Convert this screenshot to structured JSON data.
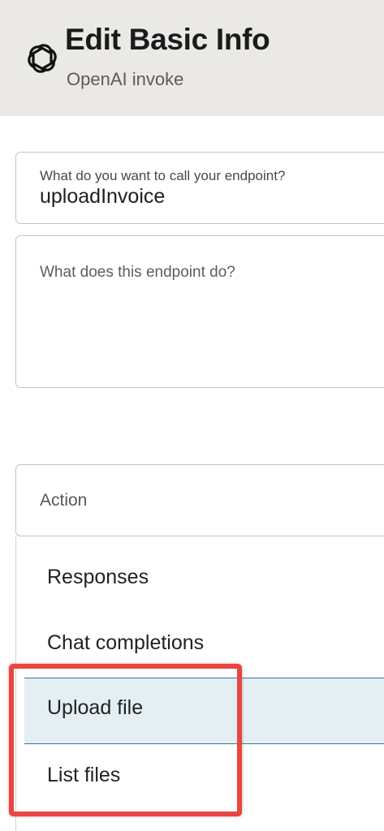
{
  "header": {
    "logo_icon": "openai-logo-icon",
    "title": "Edit Basic Info",
    "subtitle": "OpenAI invoke"
  },
  "form": {
    "endpoint_name": {
      "label": "What do you want to call your endpoint?",
      "value": "uploadInvoice"
    },
    "description": {
      "placeholder": "What does this endpoint do?",
      "value": ""
    },
    "action": {
      "label": "Action",
      "options": [
        {
          "label": "Responses"
        },
        {
          "label": "Chat completions"
        },
        {
          "label": "Upload file",
          "selected": true
        },
        {
          "label": "List files"
        }
      ]
    }
  },
  "colors": {
    "header_bg": "#ebe9e6",
    "selected_bg": "#e4eff3",
    "selected_border": "#2f7894",
    "annotation_highlight": "#e8463f"
  }
}
